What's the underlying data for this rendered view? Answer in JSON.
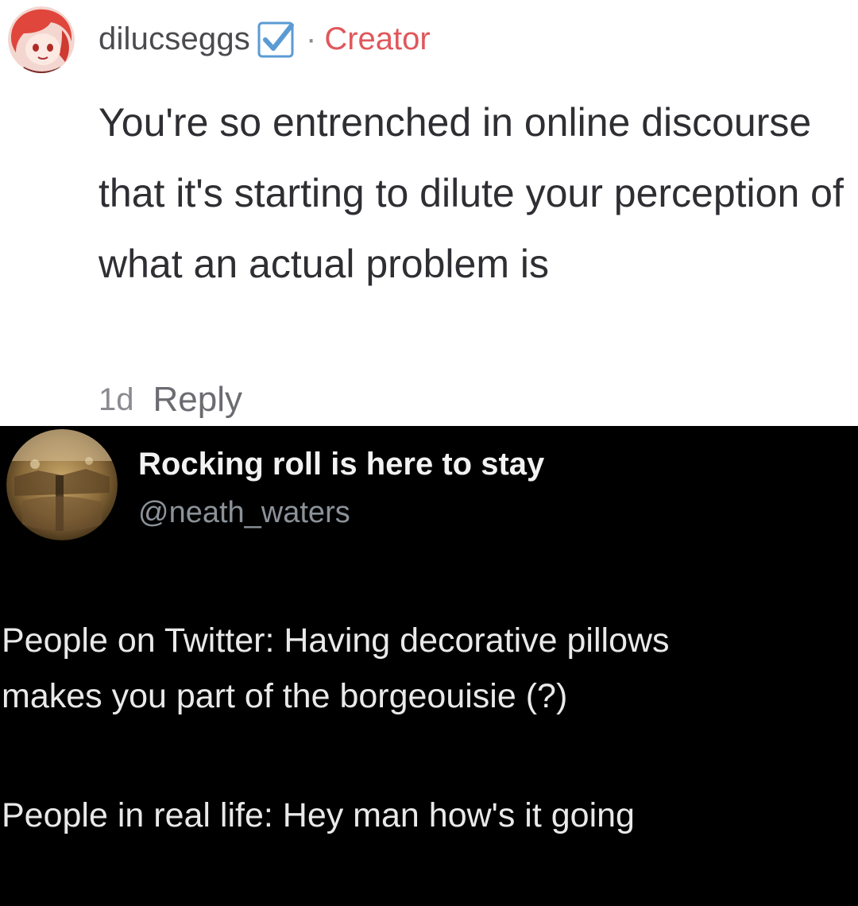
{
  "comment": {
    "username": "dilucseggs",
    "separator": "·",
    "creator_label": "Creator",
    "text": "You're so entrenched in online discourse that it's starting to dilute your perception of what an actual problem is",
    "time_ago": "1d",
    "reply_label": "Reply",
    "colors": {
      "creator": "#e0575b",
      "verified_badge": "#5b9bd5"
    },
    "icons": {
      "avatar": "avatar-anime-red-hair",
      "badge": "checkbox-verified-icon"
    }
  },
  "tweet": {
    "display_name": "Rocking roll is here to stay",
    "handle": "@neath_waters",
    "lines": [
      "People on Twitter: Having decorative pillows",
      "makes you part of the borgeouisie (?)",
      "People in real life: Hey man how's it going"
    ],
    "colors": {
      "background": "#000000",
      "handle": "#8b9299"
    },
    "icons": {
      "avatar": "avatar-sepia-photo"
    }
  }
}
